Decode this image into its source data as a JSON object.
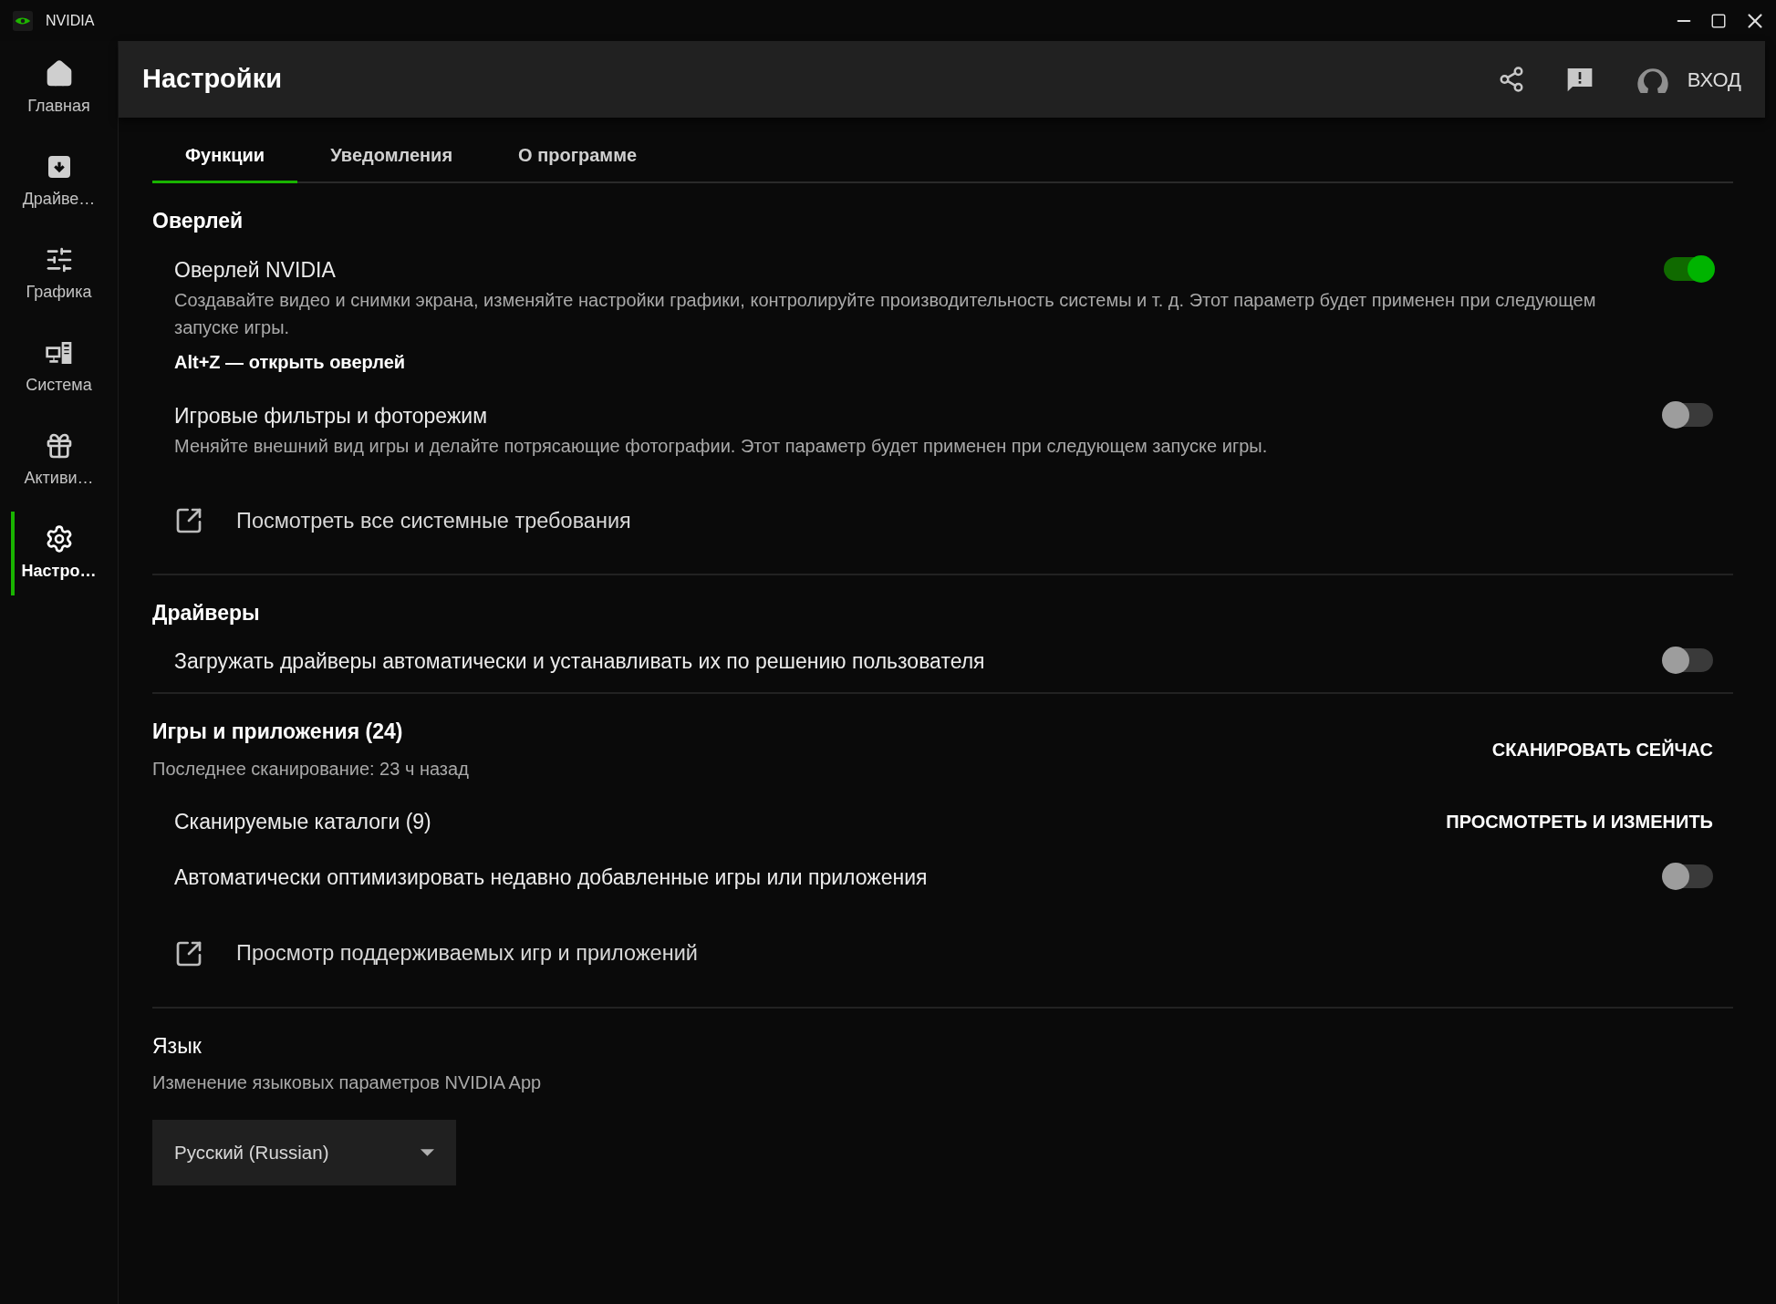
{
  "window": {
    "title": "NVIDIA"
  },
  "sidebar": {
    "items": [
      {
        "kind": "home",
        "label": "Главная",
        "selected": false
      },
      {
        "kind": "drivers",
        "label": "Драйве…",
        "selected": false
      },
      {
        "kind": "graphics",
        "label": "Графика",
        "selected": false
      },
      {
        "kind": "system",
        "label": "Система",
        "selected": false
      },
      {
        "kind": "rewards",
        "label": "Активи…",
        "selected": false
      },
      {
        "kind": "settings",
        "label": "Настро…",
        "selected": true
      }
    ]
  },
  "header": {
    "title": "Настройки",
    "signin": "ВХОД"
  },
  "tabs": [
    {
      "label": "Функции",
      "selected": true
    },
    {
      "label": "Уведомления",
      "selected": false
    },
    {
      "label": "О программе",
      "selected": false
    }
  ],
  "sections": [
    {
      "title": "Оверлей",
      "items": [
        {
          "kind": "toggle",
          "title": "Оверлей NVIDIA",
          "description": "Создавайте видео и снимки экрана, изменяйте настройки графики, контролируйте производительность системы и т. д. Этот параметр будет применен при следующем запуске игры.",
          "hint": "Alt+Z — открыть оверлей",
          "on": true
        },
        {
          "kind": "toggle",
          "title": "Игровые фильтры и фоторежим",
          "description": "Меняйте внешний вид игры и делайте потрясающие фотографии. Этот параметр будет применен при следующем запуске игры.",
          "on": false
        },
        {
          "kind": "link",
          "title": "Посмотреть все системные требования"
        }
      ]
    },
    {
      "title": "Драйверы",
      "items": [
        {
          "kind": "toggle",
          "title": "Загружать драйверы автоматически и устанавливать их по решению пользователя",
          "on": false
        }
      ]
    },
    {
      "title": "Игры и приложения (24)",
      "subtitle": "Последнее сканирование: 23 ч назад",
      "action": "СКАНИРОВАТЬ СЕЙЧАС",
      "items": [
        {
          "kind": "action",
          "title": "Сканируемые каталоги (9)",
          "action": "ПРОСМОТРЕТЬ И ИЗМЕНИТЬ"
        },
        {
          "kind": "toggle",
          "title": "Автоматически оптимизировать недавно добавленные игры или приложения",
          "on": false
        },
        {
          "kind": "link",
          "title": "Просмотр поддерживаемых игр и приложений"
        }
      ]
    },
    {
      "title": "Язык",
      "subtitle": "Изменение языковых параметров NVIDIA App",
      "dropdown": {
        "value": "Русский (Russian)"
      }
    }
  ]
}
